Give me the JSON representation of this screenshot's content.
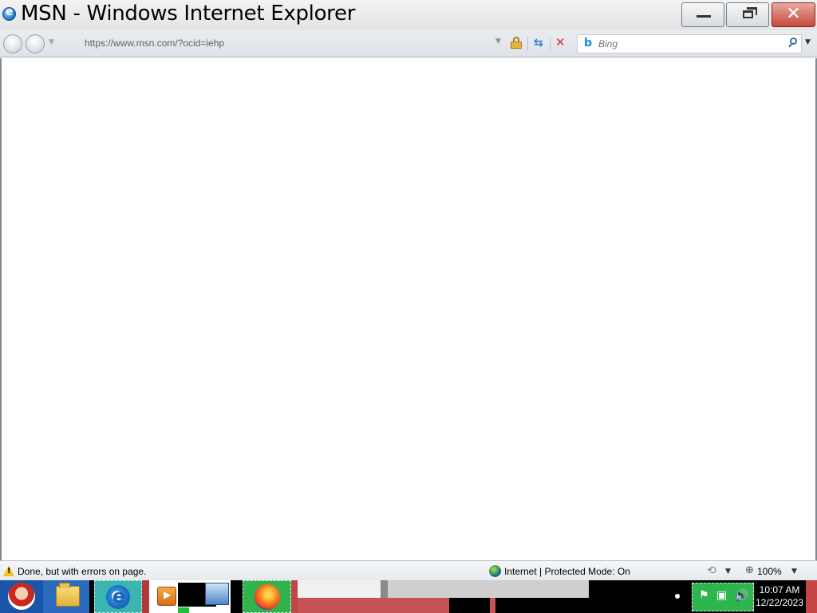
{
  "window": {
    "title": "MSN - Windows Internet Explorer",
    "controls": {
      "minimize": "—",
      "maximize": "❐",
      "close": "✕"
    }
  },
  "navbar": {
    "address_url": "https://www.msn.com/?ocid=iehp",
    "search_placeholder": "Bing"
  },
  "statusbar": {
    "message": "Done, but with errors on page.",
    "zone": "Internet | Protected Mode: On",
    "zoom": "100%"
  },
  "taskbar": {
    "clock_time": "10:07 AM",
    "clock_date": "12/22/2023"
  },
  "icons": {
    "app": "ie-icon",
    "back": "back-arrow-icon",
    "forward": "forward-arrow-icon",
    "lock": "lock-icon",
    "refresh": "refresh-icon",
    "stop": "stop-icon",
    "search": "search-icon",
    "warning": "warning-icon",
    "globe": "globe-icon",
    "zoom": "zoom-icon"
  }
}
